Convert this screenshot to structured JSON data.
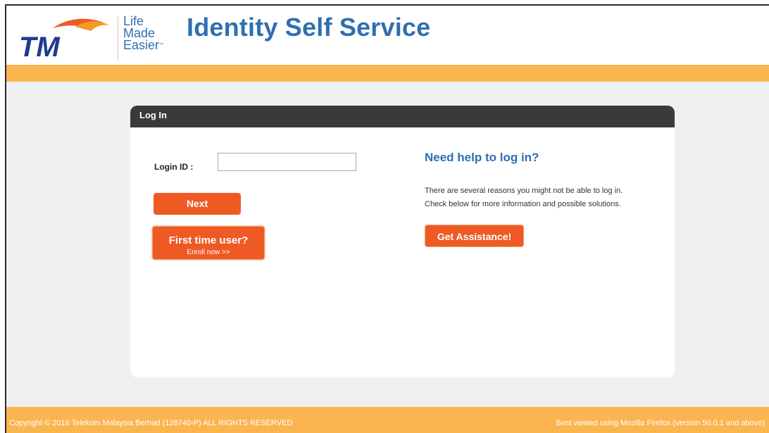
{
  "header": {
    "brand": "TM",
    "tagline": [
      "Life",
      "Made",
      "Easier"
    ],
    "trademark": "™",
    "title": "Identity Self Service"
  },
  "login": {
    "panel_title": "Log In",
    "login_id_label": "Login ID :",
    "login_id_value": "",
    "next_label": "Next",
    "enroll_title": "First time user?",
    "enroll_sub": "Enroll now >>"
  },
  "help": {
    "title": "Need help to log in?",
    "line1": "There are several reasons you might not be able to log in.",
    "line2": "Check below for more information and possible solutions.",
    "assist_label": "Get Assistance!"
  },
  "footer": {
    "copyright": "Copyright © 2016 Telekom Malaysia Berhad (128740-P) ALL RIGHTS RESERVED",
    "browser_note": "Best viewed using Mozilla Firefox (version 50.0.1 and above)"
  },
  "colors": {
    "brand_blue": "#2f6fb0",
    "accent_orange": "#fbb550",
    "button_orange": "#ef5a24",
    "panel_header": "#3a3a3a"
  }
}
